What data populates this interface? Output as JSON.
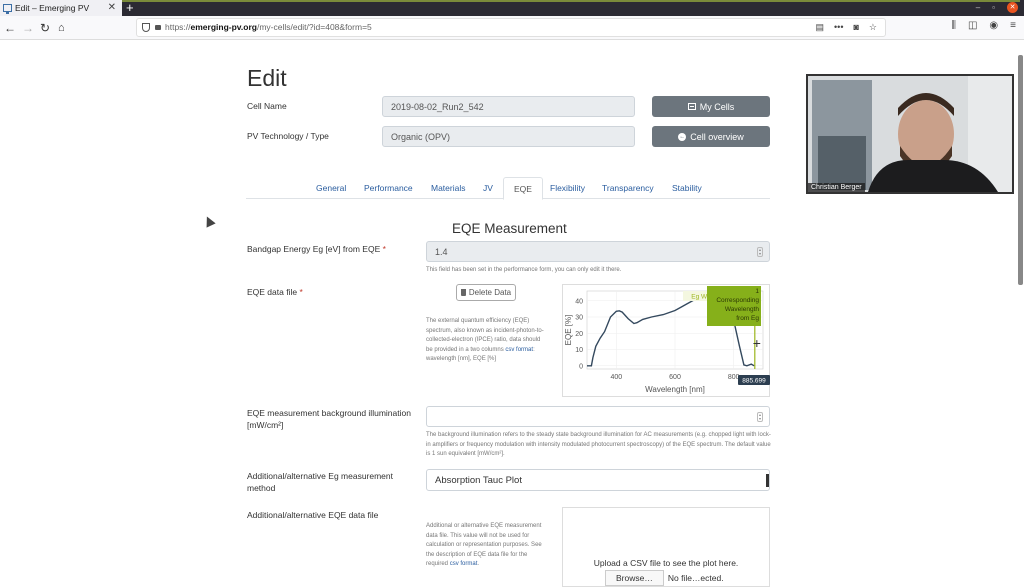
{
  "browser": {
    "tab_title": "Edit – Emerging PV",
    "url_prefix": "https://",
    "url_domain": "emerging-pv.org",
    "url_path": "/my-cells/edit/?id=408&form=5"
  },
  "page": {
    "title": "Edit",
    "cell_name_label": "Cell Name",
    "cell_name_value": "2019-08-02_Run2_542",
    "pv_type_label": "PV Technology / Type",
    "pv_type_value": "Organic (OPV)",
    "my_cells_button": "My Cells",
    "cell_overview_button": "Cell overview"
  },
  "tabs": [
    {
      "label": "General"
    },
    {
      "label": "Performance"
    },
    {
      "label": "Materials"
    },
    {
      "label": "JV"
    },
    {
      "label": "EQE",
      "active": true
    },
    {
      "label": "Flexibility"
    },
    {
      "label": "Transparency"
    },
    {
      "label": "Stability"
    }
  ],
  "eqe": {
    "section_title": "EQE Measurement",
    "bandgap_label": "Bandgap Energy Eg [eV] from EQE",
    "bandgap_value": "1.4",
    "bandgap_help": "This field has been set in the performance form, you can only edit it there.",
    "data_file_label": "EQE data file",
    "delete_button": "Delete Data",
    "data_file_help_pre": "The external quantum efficiency (EQE) spectrum, also known as incident-photon-to-collected-electron (IPCE) ratio, data should be provided in a two columns ",
    "data_file_help_link": "csv format",
    "data_file_help_post": ": wavelength [nm], EQE [%]",
    "bg_illum_label": "EQE measurement background illumination [mW/cm²]",
    "bg_illum_value": "",
    "bg_illum_help": "The background illumination refers to the steady state background illumination for AC measurements (e.g. chopped light with lock-in amplifiers or frequency modulation with intensity modulated photocurrent spectroscopy) of the EQE spectrum. The default value is 1 sun equivalent [mW/cm²].",
    "alt_eg_label": "Additional/alternative Eg measurement method",
    "alt_eg_value": "Absorption Tauc Plot",
    "alt_file_label": "Additional/alternative EQE data file",
    "alt_file_help_pre": "Additional or alternative EQE measurement data file. This value will not be used for calculation or representation purposes. See the description of EQE data file for the required ",
    "alt_file_help_link": "csv format",
    "alt_file_help_post": ".",
    "upload_msg": "Upload a CSV file to see the plot here.",
    "browse_button": "Browse…",
    "no_file_text": "No file…ected."
  },
  "video": {
    "participant_name": "Christian Berger"
  },
  "chart_data": {
    "type": "line",
    "title": "",
    "xlabel": "Wavelength [nm]",
    "ylabel": "EQE [%]",
    "xlim": [
      300,
      900
    ],
    "ylim": [
      -2,
      46
    ],
    "xticks": [
      400,
      600,
      800
    ],
    "yticks": [
      0,
      10,
      20,
      30,
      40
    ],
    "grid": true,
    "series": [
      {
        "name": "EQE",
        "color": "#34495e",
        "x": [
          300,
          315,
          320,
          330,
          345,
          360,
          380,
          400,
          410,
          420,
          440,
          460,
          470,
          490,
          520,
          560,
          600,
          620,
          640,
          660,
          680,
          700,
          720,
          740,
          760,
          780,
          800,
          820,
          835,
          845,
          860,
          870
        ],
        "y": [
          0,
          0,
          5,
          12,
          17,
          21,
          30,
          33.5,
          33.8,
          33,
          29,
          26,
          26.5,
          28.5,
          30,
          31.5,
          34,
          36,
          38,
          40,
          42,
          43,
          43.5,
          43,
          42,
          38,
          28,
          12,
          0.5,
          0,
          1,
          0
        ]
      }
    ],
    "annotations": [
      {
        "label": "Eg WL",
        "x": 885.699
      },
      {
        "label": "1 Corresponding Wavelength from Eg",
        "x": 885.699
      },
      {
        "label": "885.699",
        "x": 885.699
      }
    ]
  }
}
